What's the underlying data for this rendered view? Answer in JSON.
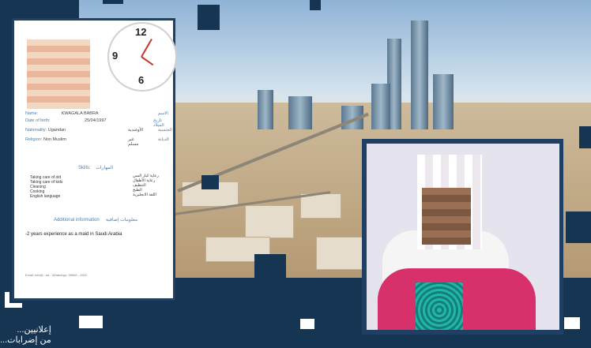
{
  "cv": {
    "fields": [
      {
        "label": "Name:",
        "value": "KWAGALA BABRA",
        "ar_label": "الاسم"
      },
      {
        "label": "Date of birth:",
        "value": "25/04/1997",
        "ar_label": "تاريخ الميلاد"
      },
      {
        "label": "Nationality:",
        "value": "Ugandan",
        "ar_value": "الأوغندية",
        "ar_label": "الجنسية"
      },
      {
        "label": "Religion:",
        "value": "Non Muslim",
        "ar_value": "غير مسلم",
        "ar_label": "الديانة"
      }
    ],
    "skills_title": "Skills:",
    "skills_title_ar": "المهارات",
    "skills": [
      "Taking care of old",
      "Taking care of kids",
      "Cleaning",
      "Cooking",
      "English language"
    ],
    "skills_ar": [
      "رعاية كبار السن",
      "رعاية الأطفال",
      "التنظيف",
      "الطبخ",
      "اللغة الانجليزية"
    ],
    "additional_title": "Additional information",
    "additional_title_ar": "معلومات إضافية",
    "additional_text": "-2 years experience as a maid in Saudi Arabia",
    "footer": "Email: info@...sa  -  WhatsApp: 05962...1922"
  },
  "clock_numbers": [
    "12",
    "9",
    "6"
  ],
  "caption": {
    "line1": "إعلانيين...",
    "line2": "من إضرابات..."
  },
  "colors": {
    "navy": "#163552",
    "frame": "#1f3f63",
    "accent_blue": "#4a7fb4"
  }
}
